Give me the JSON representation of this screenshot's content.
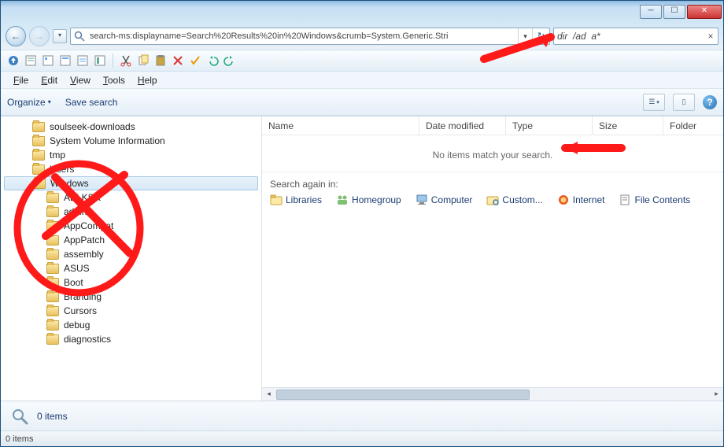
{
  "window": {
    "minimize": "─",
    "maximize": "☐",
    "close": "✕"
  },
  "nav": {
    "back": "←",
    "forward": "→",
    "drop": "▾",
    "address": "search-ms:displayname=Search%20Results%20in%20Windows&crumb=System.Generic.Stri",
    "addr_drop": "▾",
    "refresh": "↻"
  },
  "search": {
    "value": "dir  /ad  a*",
    "clear": "×"
  },
  "menu": {
    "file": "File",
    "edit": "Edit",
    "view": "View",
    "tools": "Tools",
    "help": "Help"
  },
  "cmd": {
    "organize": "Organize",
    "organize_drop": "▾",
    "save_search": "Save search",
    "view_drop": "▾",
    "help": "?"
  },
  "tree": {
    "items": [
      {
        "label": "soulseek-downloads",
        "sub": false
      },
      {
        "label": "System Volume Information",
        "sub": false
      },
      {
        "label": "tmp",
        "sub": false
      },
      {
        "label": "Users",
        "sub": false
      },
      {
        "label": "Windows",
        "sub": false,
        "selected": true
      },
      {
        "label": "ABLKSR",
        "sub": true
      },
      {
        "label": "addins",
        "sub": true
      },
      {
        "label": "AppCompat",
        "sub": true
      },
      {
        "label": "AppPatch",
        "sub": true
      },
      {
        "label": "assembly",
        "sub": true
      },
      {
        "label": "ASUS",
        "sub": true
      },
      {
        "label": "Boot",
        "sub": true
      },
      {
        "label": "Branding",
        "sub": true
      },
      {
        "label": "Cursors",
        "sub": true
      },
      {
        "label": "debug",
        "sub": true
      },
      {
        "label": "diagnostics",
        "sub": true
      }
    ]
  },
  "columns": {
    "name": "Name",
    "date": "Date modified",
    "type": "Type",
    "size": "Size",
    "folder": "Folder"
  },
  "results": {
    "empty": "No items match your search.",
    "again_label": "Search again in:",
    "links": {
      "libraries": "Libraries",
      "homegroup": "Homegroup",
      "computer": "Computer",
      "custom": "Custom...",
      "internet": "Internet",
      "filecontents": "File Contents"
    }
  },
  "details": {
    "count": "0 items"
  },
  "status": {
    "text": "0 items"
  }
}
